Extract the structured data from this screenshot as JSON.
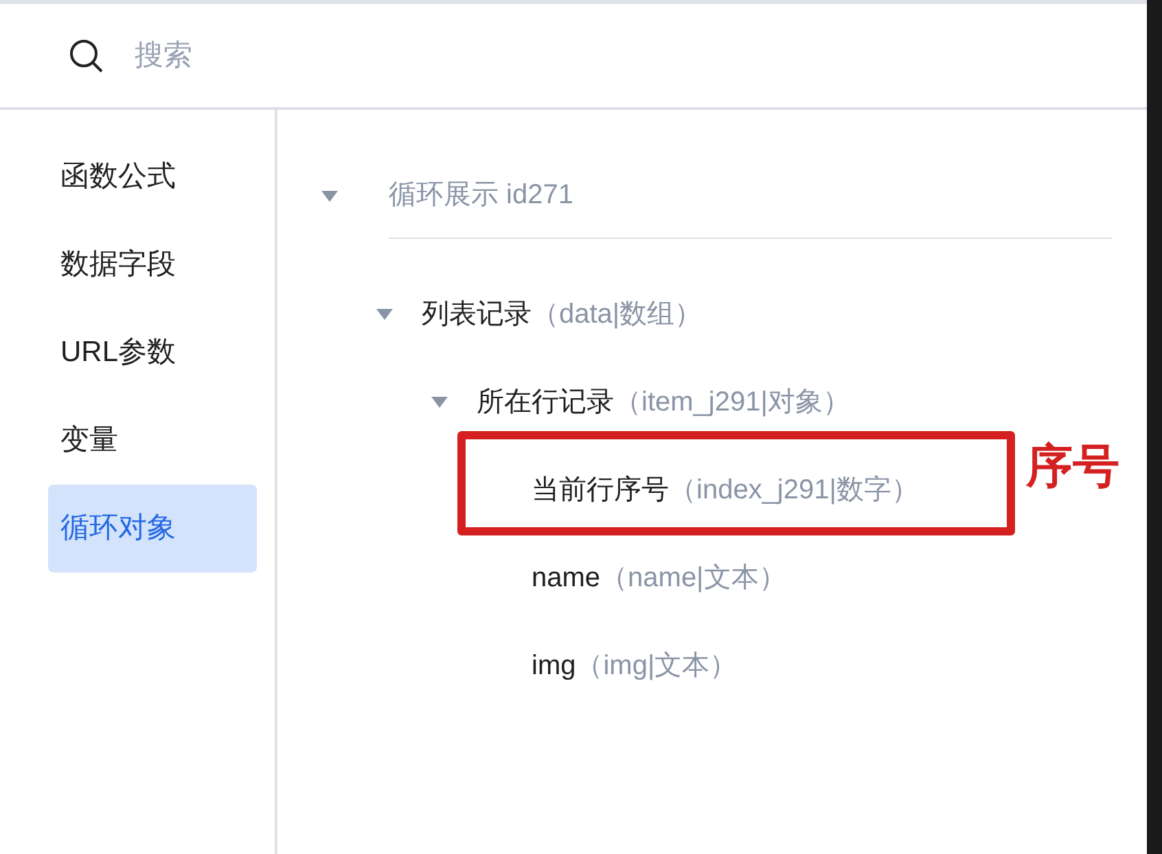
{
  "search": {
    "placeholder": "搜索"
  },
  "sidebar": {
    "items": [
      {
        "label": "函数公式",
        "selected": false
      },
      {
        "label": "数据字段",
        "selected": false
      },
      {
        "label": "URL参数",
        "selected": false
      },
      {
        "label": "变量",
        "selected": false
      },
      {
        "label": "循环对象",
        "selected": true
      }
    ]
  },
  "tree": {
    "name": "循环展示 id271",
    "expanded": true,
    "children": [
      {
        "name": "列表记录",
        "meta": "（data|数组）",
        "expanded": true,
        "children": [
          {
            "name": "所在行记录",
            "meta": "（item_j291|对象）",
            "expanded": true,
            "children": [
              {
                "name": "当前行序号",
                "meta": "（index_j291|数字）",
                "highlighted": true
              },
              {
                "name": "name",
                "meta": "（name|文本）",
                "highlighted": false
              },
              {
                "name": "img",
                "meta": "（img|文本）",
                "highlighted": false
              }
            ]
          }
        ]
      }
    ]
  },
  "annotation": {
    "label": "序号"
  }
}
